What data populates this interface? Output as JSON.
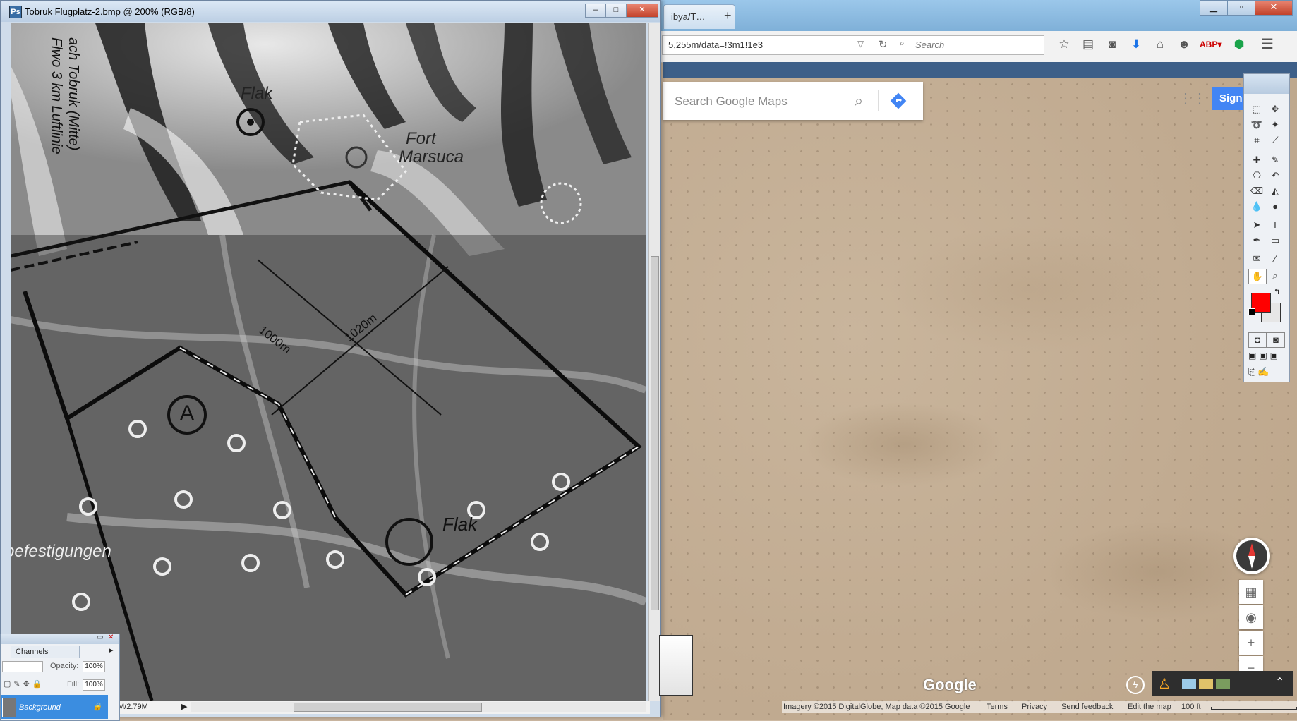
{
  "browser": {
    "tabs": [
      "",
      "ibya/T…"
    ],
    "new_tab_symbol": "+",
    "url": "5,255m/data=!3m1!1e3",
    "search_placeholder": "Search",
    "window_buttons": [
      "▁",
      "▫",
      "✕"
    ]
  },
  "maps": {
    "search_placeholder": "Search Google Maps",
    "signin_label": "Sign",
    "logo": "Google",
    "footer": {
      "imagery": "Imagery ©2015 DigitalGlobe, Map data ©2015 Google",
      "terms": "Terms",
      "privacy": "Privacy",
      "feedback": "Send feedback",
      "edit": "Edit the map",
      "scale": "100 ft"
    },
    "zoom_in": "+",
    "zoom_out": "−"
  },
  "photoshop": {
    "doc_title": "Tobruk Flugplatz-2.bmp @ 200% (RGB/8)",
    "status": "M/2.79M",
    "doc_buttons": [
      "–",
      "□",
      "✕"
    ],
    "channels_tab": "Channels",
    "opacity_label": "Opacity:",
    "opacity_value": "100%",
    "fill_label": "Fill:",
    "fill_value": "100%",
    "background_layer": "Background",
    "foreground_color": "#ff0000",
    "background_color": "#e6e6e6"
  },
  "photo_annotations": {
    "flak_top": "Flak",
    "fort": "Fort",
    "fort_name": "Marsuca",
    "length": "1000m",
    "width": "1020m",
    "marker": "A",
    "flak_bottom": "Flak",
    "left_note": "befestigungen",
    "side_note_1": "ach Tobruk (Mitte)",
    "side_note_2": "Flwo 3 km Luftlinie"
  }
}
